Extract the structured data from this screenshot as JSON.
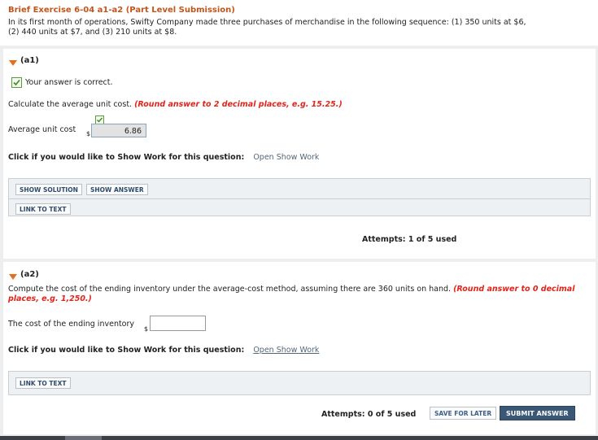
{
  "header": {
    "title": "Brief Exercise 6-04 a1-a2 (Part Level Submission)",
    "intro_line1": "In its first month of operations, Swifty Company made three purchases of merchandise in the following sequence: (1) 350 units at $6,",
    "intro_line2": "(2) 440 units at $7, and (3) 210 units at $8."
  },
  "a1": {
    "label": "(a1)",
    "correct_msg": "Your answer is correct.",
    "prompt": "Calculate the average unit cost. ",
    "prompt_hint": "(Round answer to 2 decimal places, e.g. 15.25.)",
    "field_label": "Average unit cost",
    "currency": "$",
    "value": "6.86",
    "show_work_prompt": "Click if you would like to Show Work for this question:",
    "show_work_link": "Open Show Work",
    "buttons": {
      "show_solution": "SHOW SOLUTION",
      "show_answer": "SHOW ANSWER",
      "link_to_text": "LINK TO TEXT"
    },
    "attempts": "Attempts: 1 of 5 used"
  },
  "a2": {
    "label": "(a2)",
    "prompt_line1": "Compute the cost of the ending inventory under the average-cost method, assuming there are 360 units on hand. ",
    "hint_line1": "(Round answer to 0 decimal",
    "hint_line2": "places, e.g. 1,250.)",
    "field_label": "The cost of the ending inventory",
    "currency": "$",
    "value": "",
    "show_work_prompt": "Click if you would like to Show Work for this question:",
    "show_work_link": "Open Show Work",
    "buttons": {
      "link_to_text": "LINK TO TEXT",
      "save_for_later": "SAVE FOR LATER",
      "submit_answer": "SUBMIT ANSWER"
    },
    "attempts": "Attempts: 0 of 5 used"
  },
  "colors": {
    "title": "#c5541a",
    "hint": "#e2231a",
    "submit_bg": "#3b5776",
    "arrow": "#e36f1f"
  }
}
